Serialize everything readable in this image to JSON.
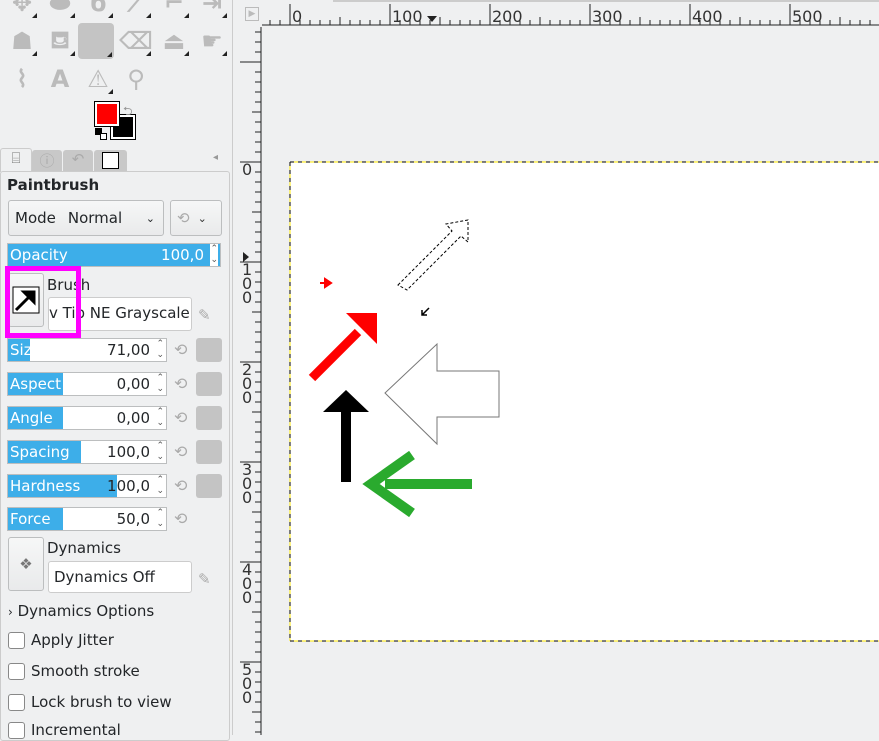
{
  "toolbox": {
    "tools": [
      "move-tool",
      "ellipse-select-tool",
      "lasso-tool",
      "fuzzy-select-tool",
      "crop-tool",
      "flip-tool",
      "warp-tool",
      "bucket-fill-tool",
      "paintbrush-tool",
      "eraser-tool",
      "clone-tool",
      "smudge-tool",
      "paths-tool",
      "text-tool",
      "measure-tool",
      "zoom-tool"
    ],
    "fg_color": "#ff0000",
    "bg_color": "#000000"
  },
  "dock_tabs": [
    "tool-options",
    "device-status",
    "undo-history",
    "images"
  ],
  "options": {
    "title": "Paintbrush",
    "mode_label": "Mode",
    "mode_value": "Normal",
    "opacity": {
      "label": "Opacity",
      "value": "100,0",
      "fraction": 1.0
    },
    "brush_label": "Brush",
    "brush_value": "v Tip NE Grayscale",
    "sliders": [
      {
        "label": "Size",
        "value": "71,00",
        "fraction": 0.14
      },
      {
        "label": "Aspect R...",
        "value": "0,00",
        "fraction": 0.35
      },
      {
        "label": "Angle",
        "value": "0,00",
        "fraction": 0.35
      },
      {
        "label": "Spacing",
        "value": "100,0",
        "fraction": 0.46
      },
      {
        "label": "Hardness",
        "value": "100,0",
        "fraction": 0.69
      },
      {
        "label": "Force",
        "value": "50,0",
        "fraction": 0.35
      }
    ],
    "dynamics_label": "Dynamics",
    "dynamics_value": "Dynamics Off",
    "dynamics_options": "Dynamics Options",
    "checks": [
      {
        "label": "Apply Jitter",
        "checked": false
      },
      {
        "label": "Smooth stroke",
        "checked": false
      },
      {
        "label": "Lock brush to view",
        "checked": false
      },
      {
        "label": "Incremental",
        "checked": false
      }
    ]
  },
  "ruler": {
    "h_labels": [
      "0",
      "100",
      "200",
      "300",
      "400",
      "500"
    ],
    "v_labels": [
      "0",
      "100",
      "200",
      "300",
      "400",
      "500"
    ]
  },
  "highlight_color": "#ff00ff"
}
